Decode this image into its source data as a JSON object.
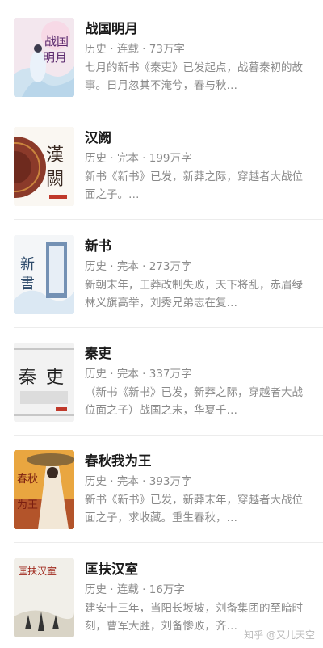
{
  "books": [
    {
      "title": "战国明月",
      "meta": "历史 · 连载 · 73万字",
      "desc": "七月的新书《秦吏》已发起点，战暮秦初的故事。日月忽其不淹兮，春与秋…",
      "cover_text": [
        "战国",
        "明月"
      ]
    },
    {
      "title": "汉阙",
      "meta": "历史 · 完本 · 199万字",
      "desc": "新书《新书》已发，新莽之际，穿越者大战位面之子。…",
      "cover_text": [
        "漢",
        "闕"
      ]
    },
    {
      "title": "新书",
      "meta": "历史 · 完本 · 273万字",
      "desc": "新朝末年，王莽改制失败，天下将乱，赤眉绿林义旗高举，刘秀兄弟志在复…",
      "cover_text": [
        "新",
        "書"
      ]
    },
    {
      "title": "秦吏",
      "meta": "历史 · 完本 · 337万字",
      "desc": "（新书《新书》已发，新莽之际，穿越者大战位面之子）战国之末，华夏千…",
      "cover_text": [
        "秦",
        "吏"
      ]
    },
    {
      "title": "春秋我为王",
      "meta": "历史 · 完本 · 393万字",
      "desc": "新书《新书》已发，新莽末年，穿越者大战位面之子，求收藏。重生春秋，…",
      "cover_text": [
        "春秋",
        "为王"
      ]
    },
    {
      "title": "匡扶汉室",
      "meta": "历史 · 连载 · 16万字",
      "desc": "建安十三年，当阳长坂坡，刘备集团的至暗时刻，曹军大胜，刘备惨败，齐…",
      "cover_text": [
        "匡扶汉室"
      ]
    }
  ],
  "watermark": "知乎 @又儿天空"
}
